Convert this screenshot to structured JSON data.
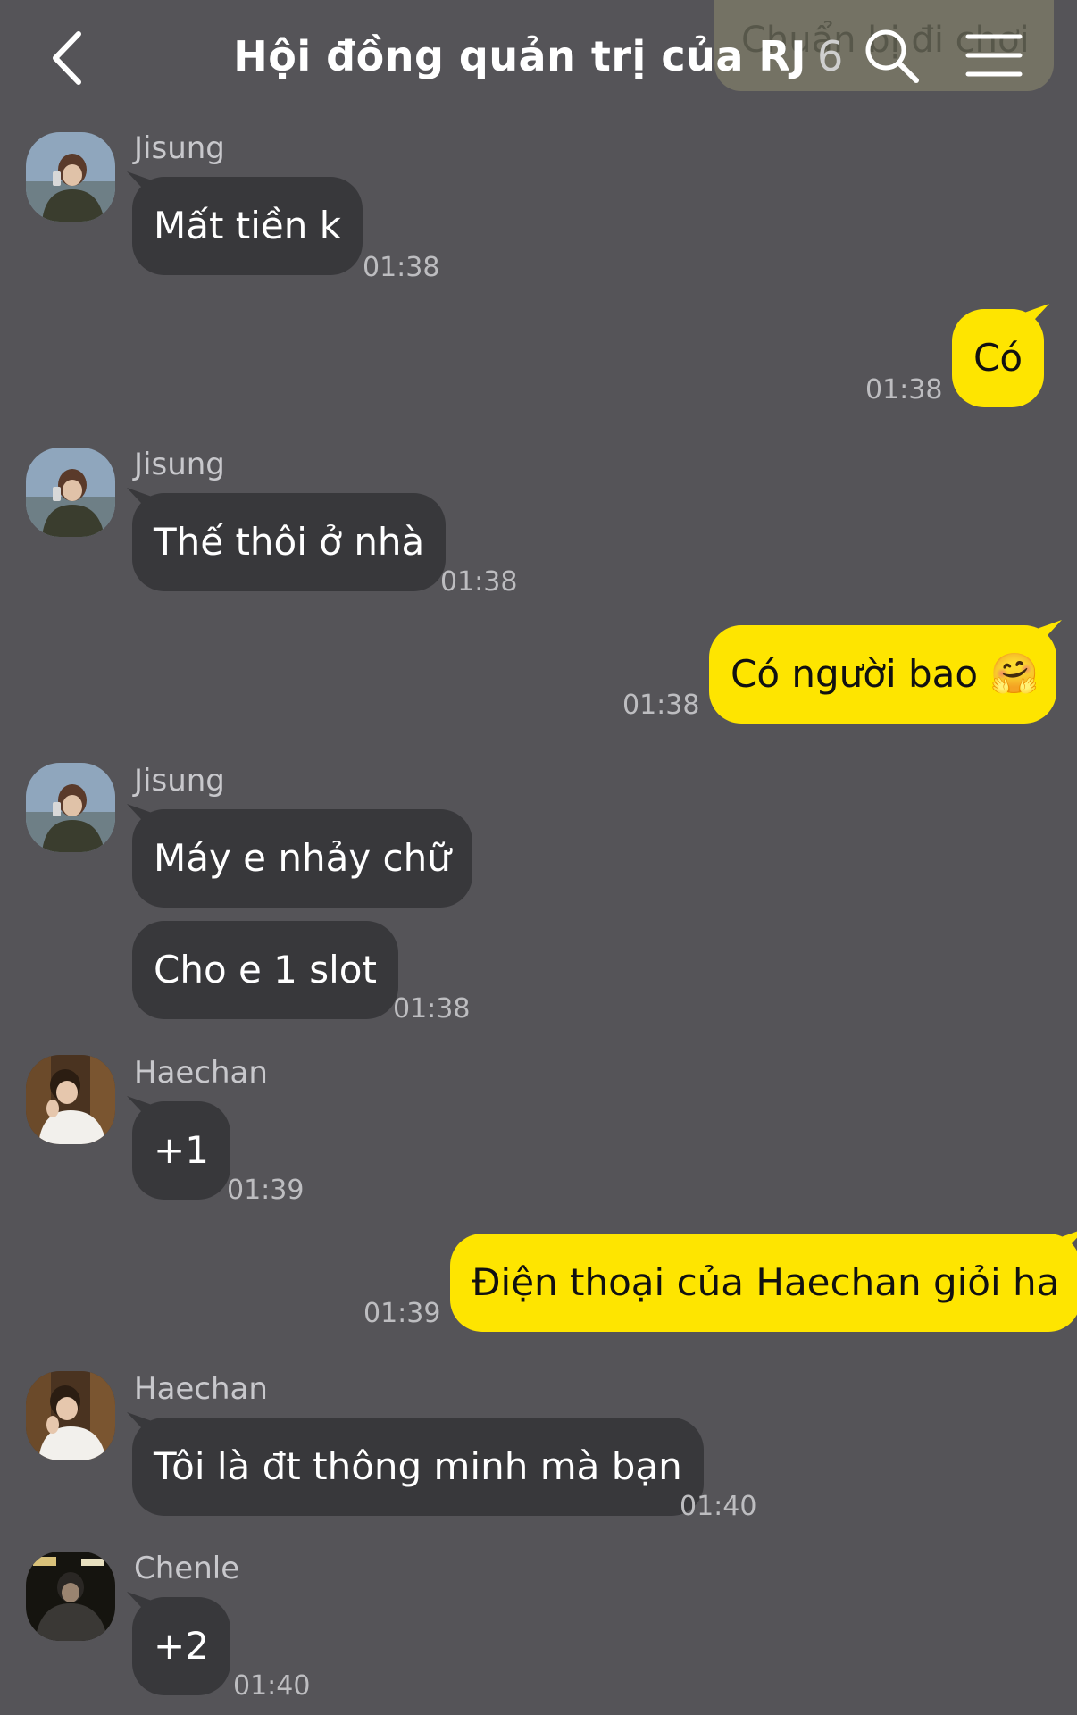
{
  "header": {
    "title": "Hội đồng quản trị của RJ",
    "member_count": "6",
    "pinned_notice": "Chuẩn bị đi chơi",
    "back_icon": "chevron-left-icon",
    "search_icon": "search-icon",
    "menu_icon": "menu-icon"
  },
  "colors": {
    "background": "#555458",
    "incoming_bubble": "#38383b",
    "outgoing_bubble": "#fee500"
  },
  "messages": [
    {
      "sender": "Jisung",
      "text": "Mất tiền k",
      "time": "01:38",
      "direction": "in"
    },
    {
      "text": "Có",
      "time": "01:38",
      "direction": "out"
    },
    {
      "sender": "Jisung",
      "text": "Thế thôi ở nhà",
      "time": "01:38",
      "direction": "in"
    },
    {
      "text": "Có người bao",
      "emoji": "🤗",
      "time": "01:38",
      "direction": "out"
    },
    {
      "sender": "Jisung",
      "text": "Máy e nhảy chữ",
      "direction": "in"
    },
    {
      "text": "Cho e 1 slot",
      "time": "01:38",
      "direction": "in"
    },
    {
      "sender": "Haechan",
      "text": "+1",
      "time": "01:39",
      "direction": "in"
    },
    {
      "text": "Điện thoại của Haechan giỏi ha",
      "time": "01:39",
      "direction": "out"
    },
    {
      "sender": "Haechan",
      "text": "Tôi là đt thông minh mà bạn",
      "time": "01:40",
      "direction": "in"
    },
    {
      "sender": "Chenle",
      "text": "+2",
      "time": "01:40",
      "direction": "in"
    }
  ]
}
